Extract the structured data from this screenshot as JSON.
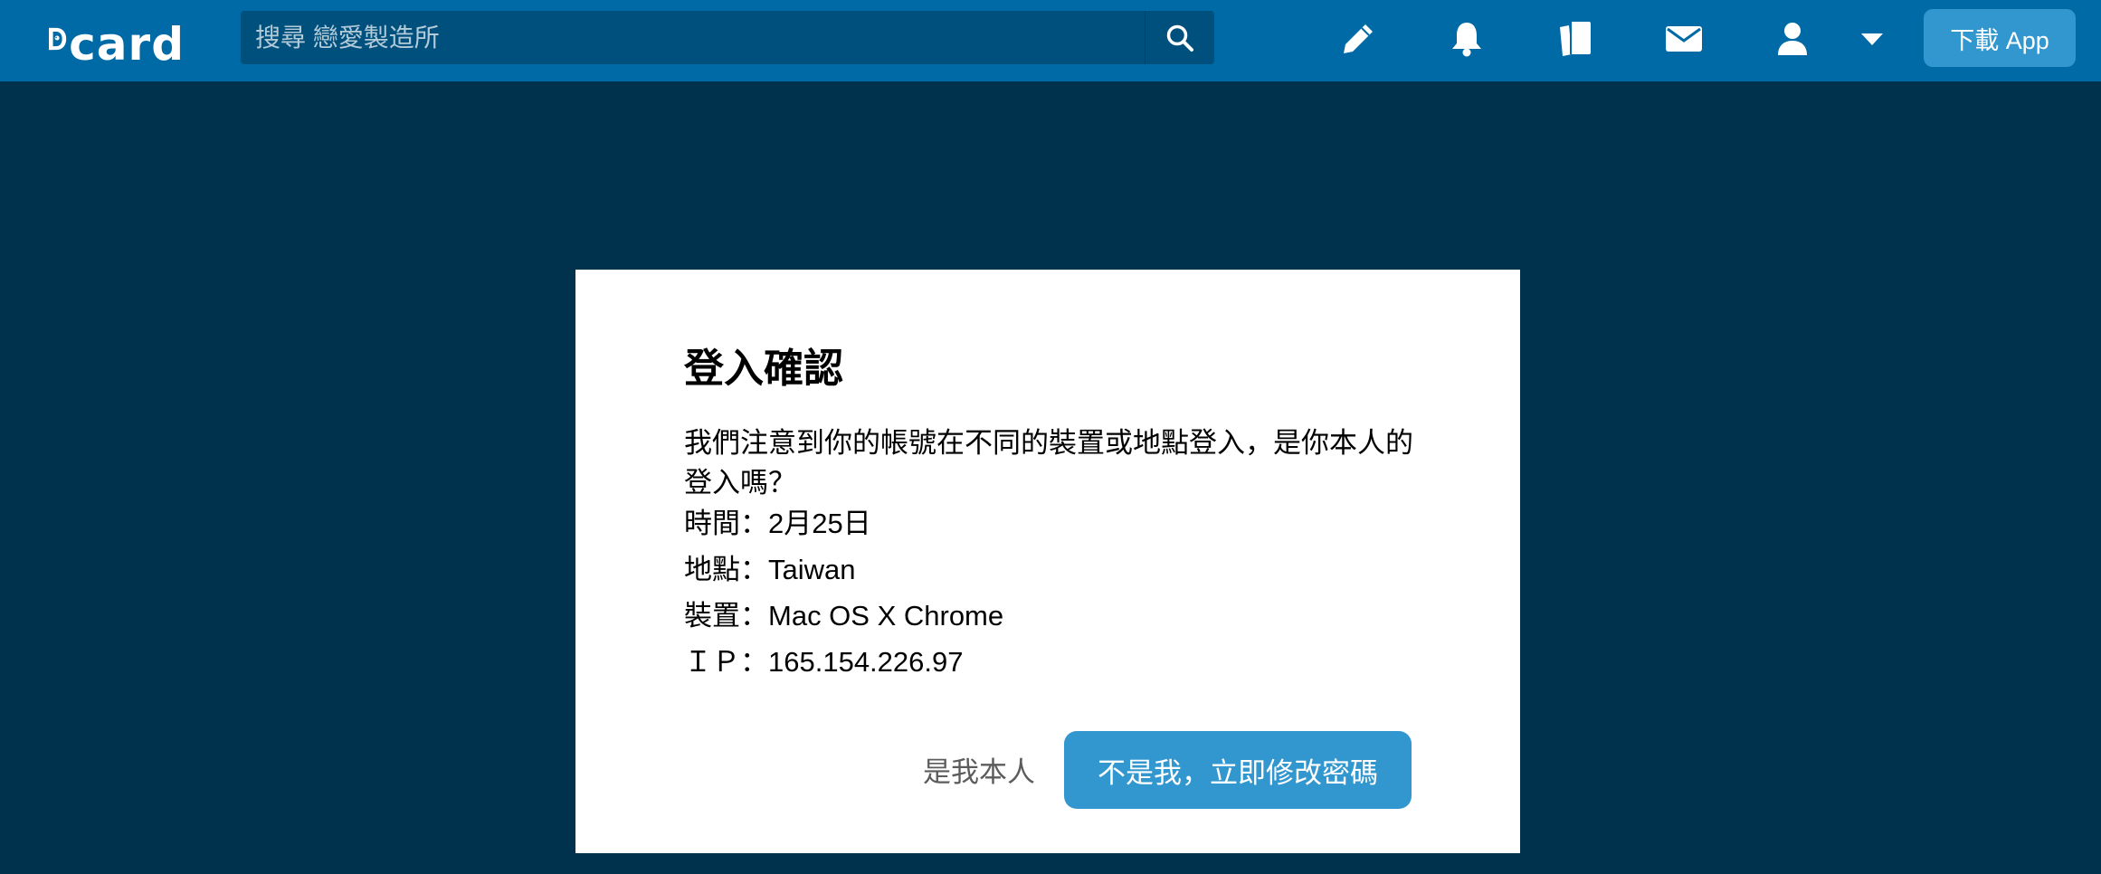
{
  "header": {
    "logo_text": "card",
    "search_placeholder": "搜尋 戀愛製造所",
    "download_label": "下載 App",
    "icons": [
      "search-icon",
      "pencil-icon",
      "bell-icon",
      "cards-icon",
      "mail-icon",
      "user-icon",
      "caret-down-icon"
    ]
  },
  "dialog": {
    "title": "登入確認",
    "message": "我們注意到你的帳號在不同的裝置或地點登入，是你本人的登入嗎？",
    "time": "時間：2月25日",
    "location": "地點：Taiwan",
    "device": "裝置：Mac OS X Chrome",
    "ip": "ＩＰ：165.154.226.97",
    "confirm_label": "是我本人",
    "reject_label": "不是我，立即修改密碼"
  },
  "colors": {
    "header_bg": "#006AA6",
    "page_bg": "#00324E",
    "search_bg": "#00507E",
    "accent": "#3397CF"
  }
}
